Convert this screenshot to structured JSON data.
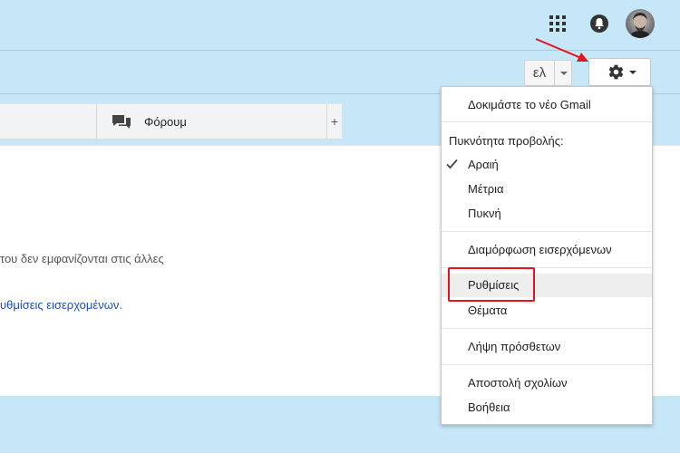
{
  "header": {
    "apps_icon": "apps-grid-icon",
    "notifications_icon": "bell-icon",
    "avatar": "user-avatar"
  },
  "toolbar": {
    "language_label": "ελ",
    "settings_icon": "gear-icon"
  },
  "tabs": {
    "forum_label": "Φόρουμ",
    "forum_icon": "chat-bubbles-icon",
    "add_label": "+"
  },
  "content": {
    "text_line": "του δεν εμφανίζονται στις άλλες",
    "link_text": "υθμίσεις εισερχομένων."
  },
  "settings_menu": {
    "try_new_gmail": "Δοκιμάστε το νέο Gmail",
    "density_heading": "Πυκνότητα προβολής:",
    "density_options": [
      "Αραιή",
      "Μέτρια",
      "Πυκνή"
    ],
    "selected_density": "Αραιή",
    "configure_inbox": "Διαμόρφωση εισερχόμενων",
    "settings": "Ρυθμίσεις",
    "themes": "Θέματα",
    "get_addons": "Λήψη πρόσθετων",
    "send_feedback": "Αποστολή σχολίων",
    "help": "Βοήθεια"
  },
  "colors": {
    "page_background": "#c6e7f7",
    "highlight_border": "#e3151a",
    "arrow": "#e3151a",
    "link": "#1a4fb5"
  }
}
